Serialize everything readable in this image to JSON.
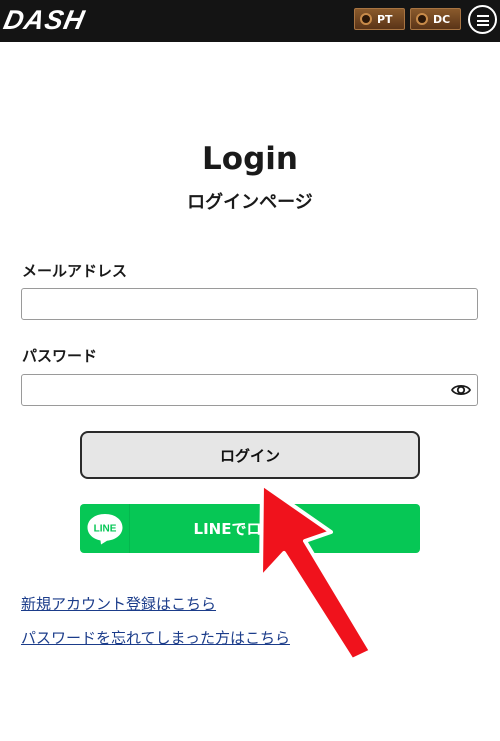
{
  "header": {
    "logo": "DASH",
    "badges": [
      {
        "label": "PT"
      },
      {
        "label": "DC"
      }
    ],
    "icons": {
      "menu": "hamburger-menu-icon",
      "coin": "coin-icon"
    }
  },
  "page": {
    "title": "Login",
    "subtitle": "ログインページ"
  },
  "form": {
    "email_label": "メールアドレス",
    "email_value": "",
    "password_label": "パスワード",
    "password_value": "",
    "login_button": "ログイン",
    "line_button": "LINEでログイン",
    "line_icon_text": "LINE"
  },
  "links": {
    "register": "新規アカウント登録はこちら",
    "forgot": "パスワードを忘れてしまった方はこちら"
  },
  "colors": {
    "header_bg": "#141414",
    "line_green": "#06c755",
    "link": "#1b3c8a",
    "arrow": "#f0121c"
  }
}
